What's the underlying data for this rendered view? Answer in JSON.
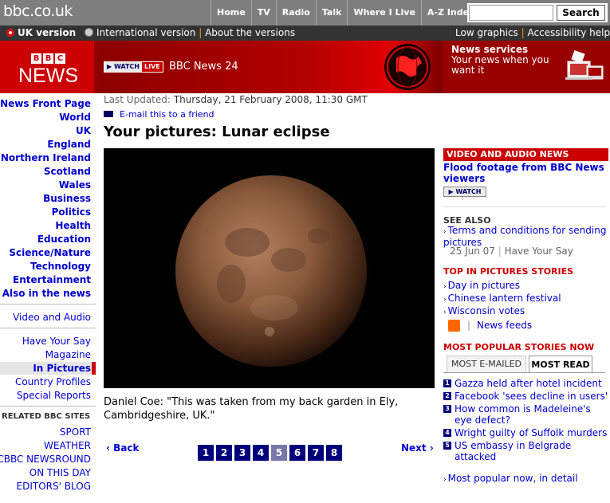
{
  "header": {
    "site_name": "bbc.co.uk",
    "nav": [
      "Home",
      "TV",
      "Radio",
      "Talk",
      "Where I Live",
      "A-Z Index"
    ],
    "search_button": "Search",
    "search_value": ""
  },
  "version_bar": {
    "uk_version": "UK version",
    "international_version": "International version",
    "about_versions": "About the versions",
    "low_graphics": "Low graphics",
    "accessibility": "Accessibility help"
  },
  "banner": {
    "logo_letters": [
      "B",
      "B",
      "C"
    ],
    "logo_word": "NEWS",
    "watch_label": "WATCH",
    "live_label": "LIVE",
    "channel": "BBC News 24",
    "services_title": "News services",
    "services_desc": "Your news when you want it"
  },
  "left_nav": {
    "primary": [
      "News Front Page",
      "World",
      "UK",
      "England",
      "Northern Ireland",
      "Scotland",
      "Wales",
      "Business",
      "Politics",
      "Health",
      "Education",
      "Science/Nature",
      "Technology",
      "Entertainment",
      "Also in the news"
    ],
    "secondary": [
      "Video and Audio"
    ],
    "tertiary": [
      "Have Your Say",
      "Magazine",
      "In Pictures",
      "Country Profiles",
      "Special Reports"
    ],
    "active": "In Pictures",
    "related_title": "RELATED BBC SITES",
    "related": [
      "SPORT",
      "WEATHER",
      "CBBC NEWSROUND",
      "ON THIS DAY",
      "EDITORS' BLOG"
    ]
  },
  "article": {
    "updated_label": "Last Updated:",
    "updated_value": "Thursday, 21 February 2008, 11:30 GMT",
    "email_link": "E-mail this to a friend",
    "title": "Your pictures: Lunar eclipse",
    "caption": "Daniel Coe: \"This was taken from my back garden in Ely, Cambridgeshire, UK.\"",
    "back": "Back",
    "next": "Next",
    "pages": [
      "1",
      "2",
      "3",
      "4",
      "5",
      "6",
      "7",
      "8"
    ],
    "current_page": "5"
  },
  "right_col": {
    "video_head": "VIDEO AND AUDIO NEWS",
    "video_link": "Flood footage from BBC News viewers",
    "watch": "WATCH",
    "see_also_head": "SEE ALSO",
    "see_also_link": "Terms and conditions for sending pictures",
    "see_also_date": "25 Jun 07",
    "see_also_section": "Have Your Say",
    "top_pics_head": "TOP IN PICTURES STORIES",
    "top_pics": [
      "Day in pictures",
      "Chinese lantern festival",
      "Wisconsin votes"
    ],
    "news_feeds": "News feeds",
    "most_popular_head": "MOST POPULAR STORIES NOW",
    "tab_emailed": "MOST E-MAILED",
    "tab_read": "MOST READ",
    "most_read": [
      {
        "num": "1",
        "text": "Gazza held after hotel incident"
      },
      {
        "num": "2",
        "text": "Facebook 'sees decline in users'"
      },
      {
        "num": "3",
        "text": "How common is Madeleine's eye defect?"
      },
      {
        "num": "4",
        "text": "Wright guilty of Suffolk murders"
      },
      {
        "num": "5",
        "text": "US embassy in Belgrade attacked"
      }
    ],
    "most_popular_link": "Most popular now, in detail"
  },
  "colors": {
    "bbc_red": "#cc0000",
    "link_blue": "#0000cc",
    "top_grey": "#7f7f7f",
    "dark_bar": "#333333"
  }
}
